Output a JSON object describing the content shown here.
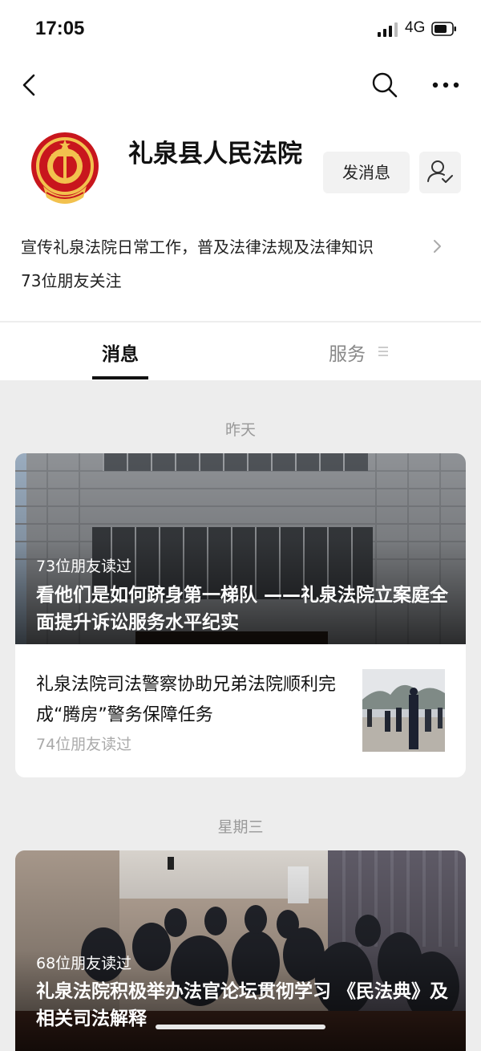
{
  "status_bar": {
    "time": "17:05",
    "network": "4G"
  },
  "account": {
    "name": "礼泉县人民法院",
    "send_message_label": "发消息",
    "description": "宣传礼泉法院日常工作，普及法律法规及法律知识",
    "followers": "73位朋友关注"
  },
  "tabs": {
    "messages": "消息",
    "services": "服务"
  },
  "feed": [
    {
      "date": "昨天",
      "hero": {
        "reads": "73位朋友读过",
        "title": "看他们是如何跻身第一梯队 ——礼泉法院立案庭全面提升诉讼服务水平纪实"
      },
      "sub": {
        "title": "礼泉法院司法警察协助兄弟法院顺利完成“腾房”警务保障任务",
        "reads": "74位朋友读过"
      }
    },
    {
      "date": "星期三",
      "hero": {
        "reads": "68位朋友读过",
        "title": "礼泉法院积极举办法官论坛贯彻学习 《民法典》及相关司法解释"
      }
    }
  ],
  "colors": {
    "emblem_red": "#c8161d",
    "emblem_gold": "#f2c14e",
    "accent_text": "#111111",
    "muted_text": "#999999"
  }
}
